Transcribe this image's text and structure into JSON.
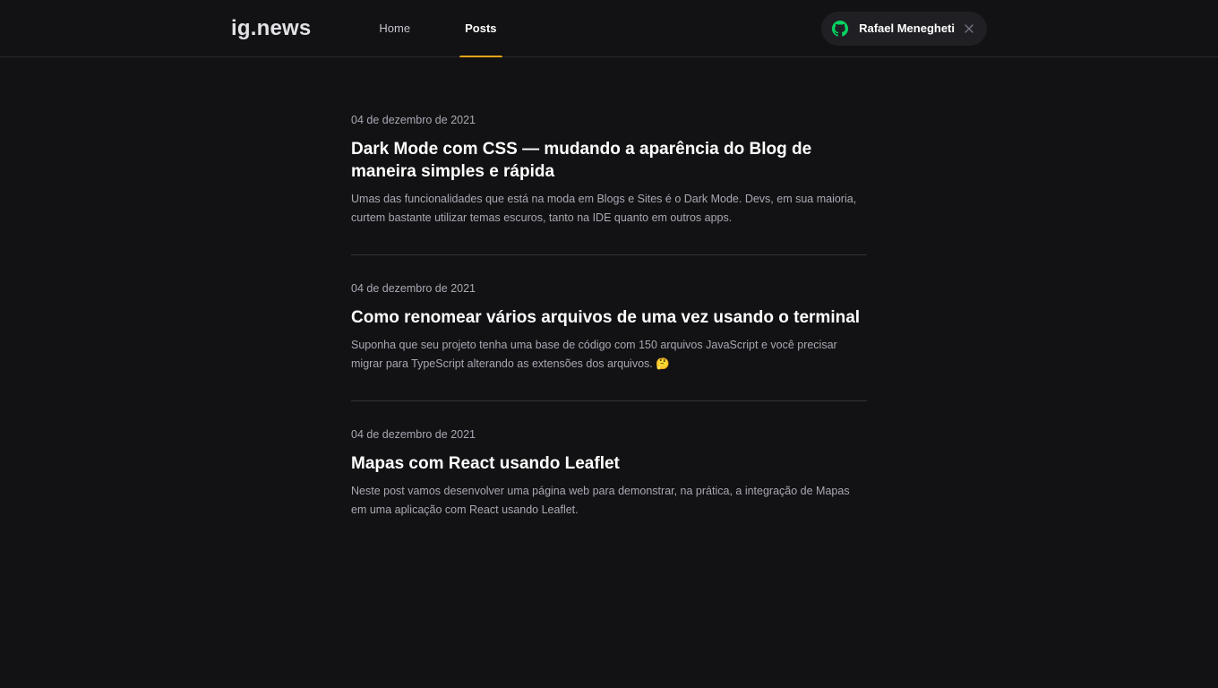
{
  "header": {
    "logo": "ig.news",
    "nav": [
      {
        "label": "Home",
        "active": false
      },
      {
        "label": "Posts",
        "active": true
      }
    ],
    "user": {
      "name": "Rafael Menegheti",
      "icon": "github-icon",
      "close_icon": "close-icon"
    }
  },
  "colors": {
    "background": "#121214",
    "accent": "#eba417",
    "github_green": "#04d361"
  },
  "posts": [
    {
      "date": "04 de dezembro de 2021",
      "title": "Dark Mode com CSS — mudando a aparência do Blog de maneira simples e rápida",
      "excerpt": "Umas das funcionalidades que está na moda em Blogs e Sites é o Dark Mode. Devs, em sua maioria, curtem bastante utilizar temas escuros, tanto na IDE quanto em outros apps."
    },
    {
      "date": "04 de dezembro de 2021",
      "title": "Como renomear vários arquivos de uma vez usando o terminal",
      "excerpt": "Suponha que seu projeto tenha uma base de código com 150 arquivos JavaScript e você precisar migrar para TypeScript alterando as extensões dos arquivos. 🤔"
    },
    {
      "date": "04 de dezembro de 2021",
      "title": "Mapas com React usando Leaflet",
      "excerpt": "Neste post vamos desenvolver uma página web para demonstrar, na prática, a integração de Mapas em uma aplicação com React usando Leaflet."
    }
  ]
}
